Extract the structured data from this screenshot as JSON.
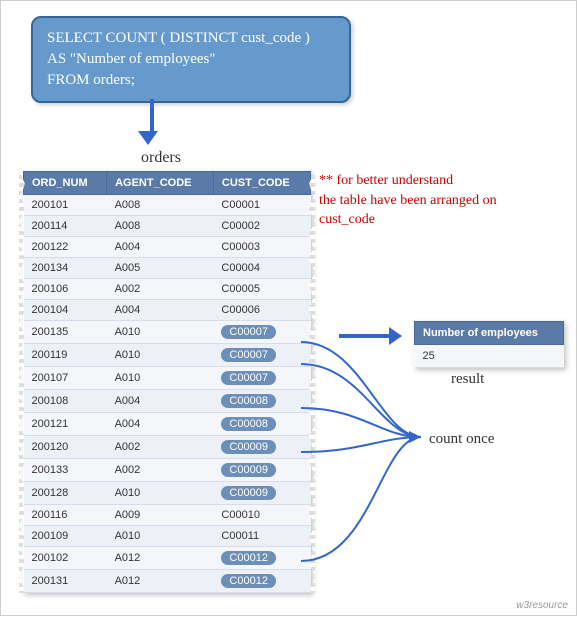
{
  "sql": {
    "line1": "SELECT COUNT ( DISTINCT cust_code )",
    "line2": "AS \"Number of employees\"",
    "line3": "FROM orders;"
  },
  "labels": {
    "orders": "orders",
    "result": "result",
    "count_once": "count once",
    "note_l1": "** for better understand",
    "note_l2": "the table have been arranged on",
    "note_l3": "cust_code",
    "footer": "w3resource"
  },
  "orders_table": {
    "headers": [
      "ORD_NUM",
      "AGENT_CODE",
      "CUST_CODE"
    ],
    "rows": [
      {
        "ord_num": "200101",
        "agent_code": "A008",
        "cust_code": "C00001",
        "hl": false
      },
      {
        "ord_num": "200114",
        "agent_code": "A008",
        "cust_code": "C00002",
        "hl": false
      },
      {
        "ord_num": "200122",
        "agent_code": "A004",
        "cust_code": "C00003",
        "hl": false
      },
      {
        "ord_num": "200134",
        "agent_code": "A005",
        "cust_code": "C00004",
        "hl": false
      },
      {
        "ord_num": "200106",
        "agent_code": "A002",
        "cust_code": "C00005",
        "hl": false
      },
      {
        "ord_num": "200104",
        "agent_code": "A004",
        "cust_code": "C00006",
        "hl": false
      },
      {
        "ord_num": "200135",
        "agent_code": "A010",
        "cust_code": "C00007",
        "hl": true
      },
      {
        "ord_num": "200119",
        "agent_code": "A010",
        "cust_code": "C00007",
        "hl": true
      },
      {
        "ord_num": "200107",
        "agent_code": "A010",
        "cust_code": "C00007",
        "hl": true
      },
      {
        "ord_num": "200108",
        "agent_code": "A004",
        "cust_code": "C00008",
        "hl": true
      },
      {
        "ord_num": "200121",
        "agent_code": "A004",
        "cust_code": "C00008",
        "hl": true
      },
      {
        "ord_num": "200120",
        "agent_code": "A002",
        "cust_code": "C00009",
        "hl": true
      },
      {
        "ord_num": "200133",
        "agent_code": "A002",
        "cust_code": "C00009",
        "hl": true
      },
      {
        "ord_num": "200128",
        "agent_code": "A010",
        "cust_code": "C00009",
        "hl": true
      },
      {
        "ord_num": "200116",
        "agent_code": "A009",
        "cust_code": "C00010",
        "hl": false
      },
      {
        "ord_num": "200109",
        "agent_code": "A010",
        "cust_code": "C00011",
        "hl": false
      },
      {
        "ord_num": "200102",
        "agent_code": "A012",
        "cust_code": "C00012",
        "hl": true
      },
      {
        "ord_num": "200131",
        "agent_code": "A012",
        "cust_code": "C00012",
        "hl": true
      }
    ]
  },
  "result_table": {
    "header": "Number of employees",
    "value": "25"
  }
}
